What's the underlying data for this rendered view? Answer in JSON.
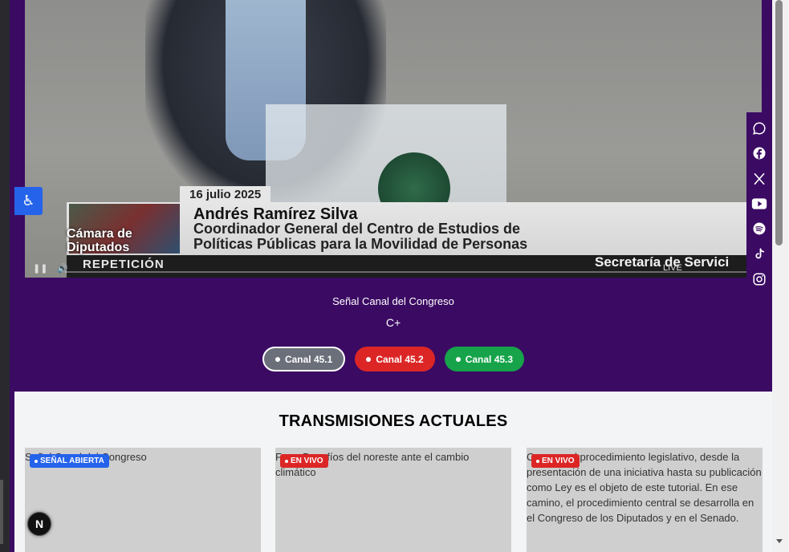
{
  "video": {
    "date": "16 julio 2025",
    "logo_text": "Cámara de Diputados",
    "speaker_name": "Andrés Ramírez Silva",
    "speaker_role_line1": "Coordinador General del Centro de Estudios de",
    "speaker_role_line2": "Políticas Públicas para la Movilidad de Personas",
    "repeat_label": "REPETICIÓN",
    "secretaria_label": "Secretaría de Servici",
    "controls": {
      "pause": "❚❚",
      "volume": "🔊",
      "live": "LIVE"
    }
  },
  "accessibility_button": {
    "icon": "♿"
  },
  "signal": {
    "title": "Señal Canal del Congreso",
    "subtitle": "C+"
  },
  "channels": [
    {
      "label": "Canal 45.1",
      "color": "#6b6f7a",
      "active": true
    },
    {
      "label": "Canal 45.2",
      "color": "#dc2626",
      "active": false
    },
    {
      "label": "Canal 45.3",
      "color": "#16a34a",
      "active": false
    }
  ],
  "section": {
    "title": "TRANSMISIONES ACTUALES"
  },
  "cards": [
    {
      "alt": "Señal Canal del Congreso",
      "badge": "SEÑAL ABIERTA",
      "badge_color": "#2563eb"
    },
    {
      "alt": "Foro: Desafíos del noreste ante el cambio climático",
      "badge": "EN VIVO",
      "badge_color": "#dc2626"
    },
    {
      "alt": "Conocer el procedimiento legislativo, desde la presentación de una iniciativa hasta su publicación como Ley es el objeto de este tutorial. En ese camino, el procedimiento central se desarrolla en el Congreso de los Diputados y en el Senado.",
      "badge": "EN VIVO",
      "badge_color": "#dc2626"
    }
  ],
  "next_badge": {
    "letter": "N"
  },
  "social_icons": [
    "whatsapp-icon",
    "facebook-icon",
    "x-icon",
    "youtube-icon",
    "spotify-icon",
    "tiktok-icon",
    "instagram-icon"
  ]
}
